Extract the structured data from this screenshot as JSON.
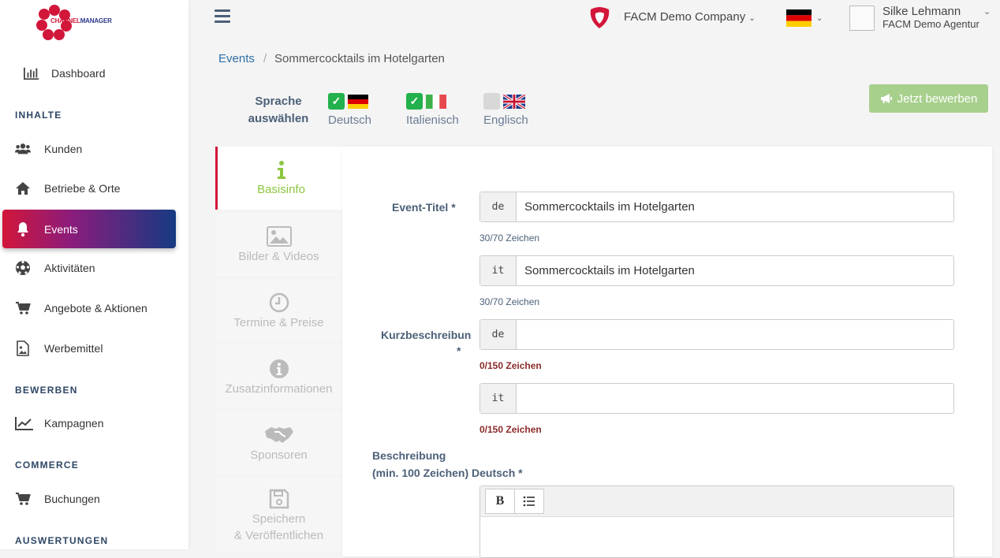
{
  "logo": {
    "text_a": "CHANNEL",
    "text_b": "MANAGER"
  },
  "sidebar": {
    "dashboard": "Dashboard",
    "section_content": "INHALTE",
    "customers": "Kunden",
    "businesses": "Betriebe & Orte",
    "events": "Events",
    "activities": "Aktivitäten",
    "offers": "Angebote & Aktionen",
    "advertising": "Werbemittel",
    "section_promote": "BEWERBEN",
    "campaigns": "Kampagnen",
    "section_commerce": "COMMERCE",
    "bookings": "Buchungen",
    "section_reports": "AUSWERTUNGEN"
  },
  "topbar": {
    "company": "FACM Demo Company",
    "user_name": "Silke Lehmann",
    "user_agency": "FACM Demo Agentur"
  },
  "breadcrumb": {
    "root": "Events",
    "sep": "/",
    "current": "Sommercocktails im Hotelgarten"
  },
  "language": {
    "label": "Sprache auswählen",
    "options": [
      {
        "label": "Deutsch",
        "checked": true
      },
      {
        "label": "Italienisch",
        "checked": true
      },
      {
        "label": "Englisch",
        "checked": false
      }
    ]
  },
  "promote_button": "Jetzt bewerben",
  "tabs": [
    "Basisinfo",
    "Bilder & Videos",
    "Termine & Preise",
    "Zusatzinformationen",
    "Sponsoren",
    "Speichern & Veröffentlichen"
  ],
  "tab_save_line1": "Speichern",
  "tab_save_line2": "& Veröffentlichen",
  "form": {
    "title_label": "Event-Titel *",
    "title_de_lang": "de",
    "title_de_value": "Sommercocktails im Hotelgarten",
    "title_de_count": "30/70 Zeichen",
    "title_it_lang": "it",
    "title_it_value": "Sommercocktails im Hotelgarten",
    "title_it_count": "30/70 Zeichen",
    "short_label": "Kurzbeschreibun",
    "short_label_star": "*",
    "short_de_lang": "de",
    "short_de_value": "",
    "short_de_count": "0/150 Zeichen",
    "short_it_lang": "it",
    "short_it_value": "",
    "short_it_count": "0/150 Zeichen",
    "desc_label_1": "Beschreibung",
    "desc_label_2": "(min. 100 Zeichen) Deutsch *",
    "bold_button": "B"
  }
}
